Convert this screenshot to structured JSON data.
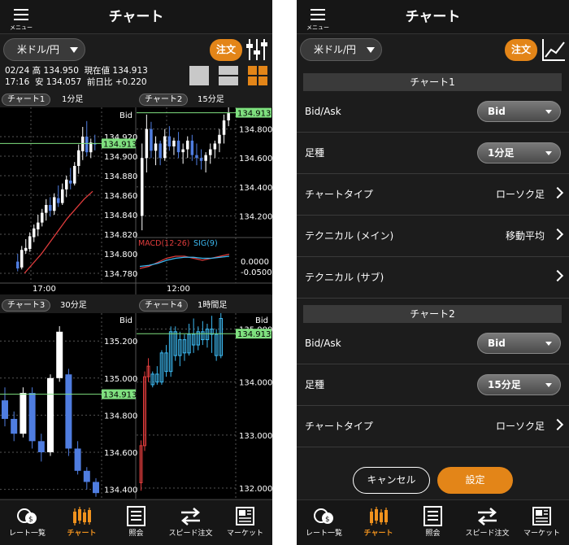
{
  "header": {
    "menu_label": "メニュー",
    "title": "チャート"
  },
  "currency_pair": "米ドル/円",
  "order_button": "注文",
  "quote": {
    "date": "02/24",
    "time": "17:16",
    "high_label": "高",
    "high": "134.950",
    "low_label": "安",
    "low": "134.057",
    "current_label": "現在値",
    "current": "134.913",
    "change_label": "前日比",
    "change": "+0.220"
  },
  "colors": {
    "accent": "#e38518",
    "up": "#ffffff",
    "down": "#4f7de0",
    "price_line": "#7fe07f",
    "macd": "#e03c3c",
    "signal": "#3cb8f0"
  },
  "charts": [
    {
      "tag": "チャート1",
      "timeframe": "1分足",
      "price_type": "Bid",
      "price": "134.913",
      "y_ticks": [
        "134.920",
        "134.900",
        "134.880",
        "134.860",
        "134.840",
        "134.820",
        "134.800",
        "134.780"
      ],
      "x_label": "17:00"
    },
    {
      "tag": "チャート2",
      "timeframe": "15分足",
      "price_type": "Bid",
      "price": "134.913",
      "y_ticks": [
        "134.800",
        "134.600",
        "134.400",
        "134.200"
      ],
      "x_label": "12:00",
      "macd_label": "MACD(12-26)",
      "sig_label": "SIG(9)",
      "macd_ticks": [
        "0.0000",
        "-0.0500"
      ]
    },
    {
      "tag": "チャート3",
      "timeframe": "30分足",
      "price_type": "Bid",
      "price": "134.913",
      "y_ticks": [
        "135.200",
        "135.000",
        "134.800",
        "134.600",
        "134.400"
      ]
    },
    {
      "tag": "チャート4",
      "timeframe": "1時間足",
      "price_type": "Bid",
      "price": "134.913",
      "y_ticks": [
        "135.000",
        "134.000",
        "133.000",
        "132.000"
      ]
    }
  ],
  "settings": {
    "sections": [
      {
        "title": "チャート1",
        "rows": [
          {
            "label": "Bid/Ask",
            "value": "Bid"
          },
          {
            "label": "足種",
            "value": "1分足"
          },
          {
            "label": "チャートタイプ",
            "value": "ローソク足"
          },
          {
            "label": "テクニカル (メイン)",
            "value": "移動平均"
          },
          {
            "label": "テクニカル (サブ)",
            "value": ""
          }
        ]
      },
      {
        "title": "チャート2",
        "rows": [
          {
            "label": "Bid/Ask",
            "value": "Bid"
          },
          {
            "label": "足種",
            "value": "15分足"
          },
          {
            "label": "チャートタイプ",
            "value": "ローソク足"
          }
        ]
      }
    ],
    "cancel": "キャンセル",
    "confirm": "設定"
  },
  "tabs": [
    {
      "label": "レート一覧",
      "icon": "coins-icon"
    },
    {
      "label": "チャート",
      "icon": "candlestick-icon"
    },
    {
      "label": "照会",
      "icon": "list-icon"
    },
    {
      "label": "スピード注文",
      "icon": "swap-arrows-icon"
    },
    {
      "label": "マーケット",
      "icon": "newspaper-icon"
    }
  ],
  "chart_data": [
    {
      "type": "candlestick",
      "title": "チャート1 1分足",
      "ylim": [
        134.77,
        134.95
      ],
      "price_line": 134.913,
      "candles_ohlc": [
        [
          134.792,
          134.8,
          134.782,
          134.785
        ],
        [
          134.786,
          134.808,
          134.784,
          134.804
        ],
        [
          134.803,
          134.815,
          134.8,
          134.806
        ],
        [
          134.805,
          134.822,
          134.802,
          134.818
        ],
        [
          134.817,
          134.83,
          134.812,
          134.826
        ],
        [
          134.825,
          134.84,
          134.818,
          134.832
        ],
        [
          134.832,
          134.846,
          134.828,
          134.842
        ],
        [
          134.842,
          134.856,
          134.834,
          134.85
        ],
        [
          134.85,
          134.858,
          134.838,
          134.844
        ],
        [
          134.844,
          134.862,
          134.84,
          134.858
        ],
        [
          134.857,
          134.87,
          134.848,
          134.852
        ],
        [
          134.852,
          134.872,
          134.85,
          134.866
        ],
        [
          134.866,
          134.88,
          134.858,
          134.876
        ],
        [
          134.875,
          134.888,
          134.866,
          134.872
        ],
        [
          134.872,
          134.894,
          134.87,
          134.89
        ],
        [
          134.89,
          134.912,
          134.882,
          134.906
        ],
        [
          134.905,
          134.93,
          134.896,
          134.92
        ],
        [
          134.92,
          134.936,
          134.9,
          134.904
        ],
        [
          134.904,
          134.918,
          134.898,
          134.914
        ],
        [
          134.913,
          134.922,
          134.906,
          134.912
        ]
      ],
      "ma": [
        134.78,
        134.79,
        134.8,
        134.812,
        134.824,
        134.836,
        134.846,
        134.856,
        134.864
      ]
    },
    {
      "type": "candlestick",
      "title": "チャート2 15分足",
      "ylim": [
        134.05,
        134.95
      ],
      "price_line": 134.913,
      "macd": [
        -0.04,
        -0.03,
        -0.01,
        0.01,
        0.02,
        0.02,
        0.01,
        0.0,
        0.01,
        0.02,
        0.03
      ],
      "signal": [
        -0.03,
        -0.025,
        -0.015,
        0.0,
        0.01,
        0.015,
        0.015,
        0.01,
        0.01,
        0.015,
        0.02
      ]
    },
    {
      "type": "candlestick",
      "title": "チャート3 30分足",
      "ylim": [
        134.35,
        135.35
      ],
      "price_line": 134.913
    },
    {
      "type": "candlestick",
      "title": "チャート4 1時間足",
      "ylim": [
        131.8,
        135.3
      ],
      "price_line": 134.913
    }
  ]
}
